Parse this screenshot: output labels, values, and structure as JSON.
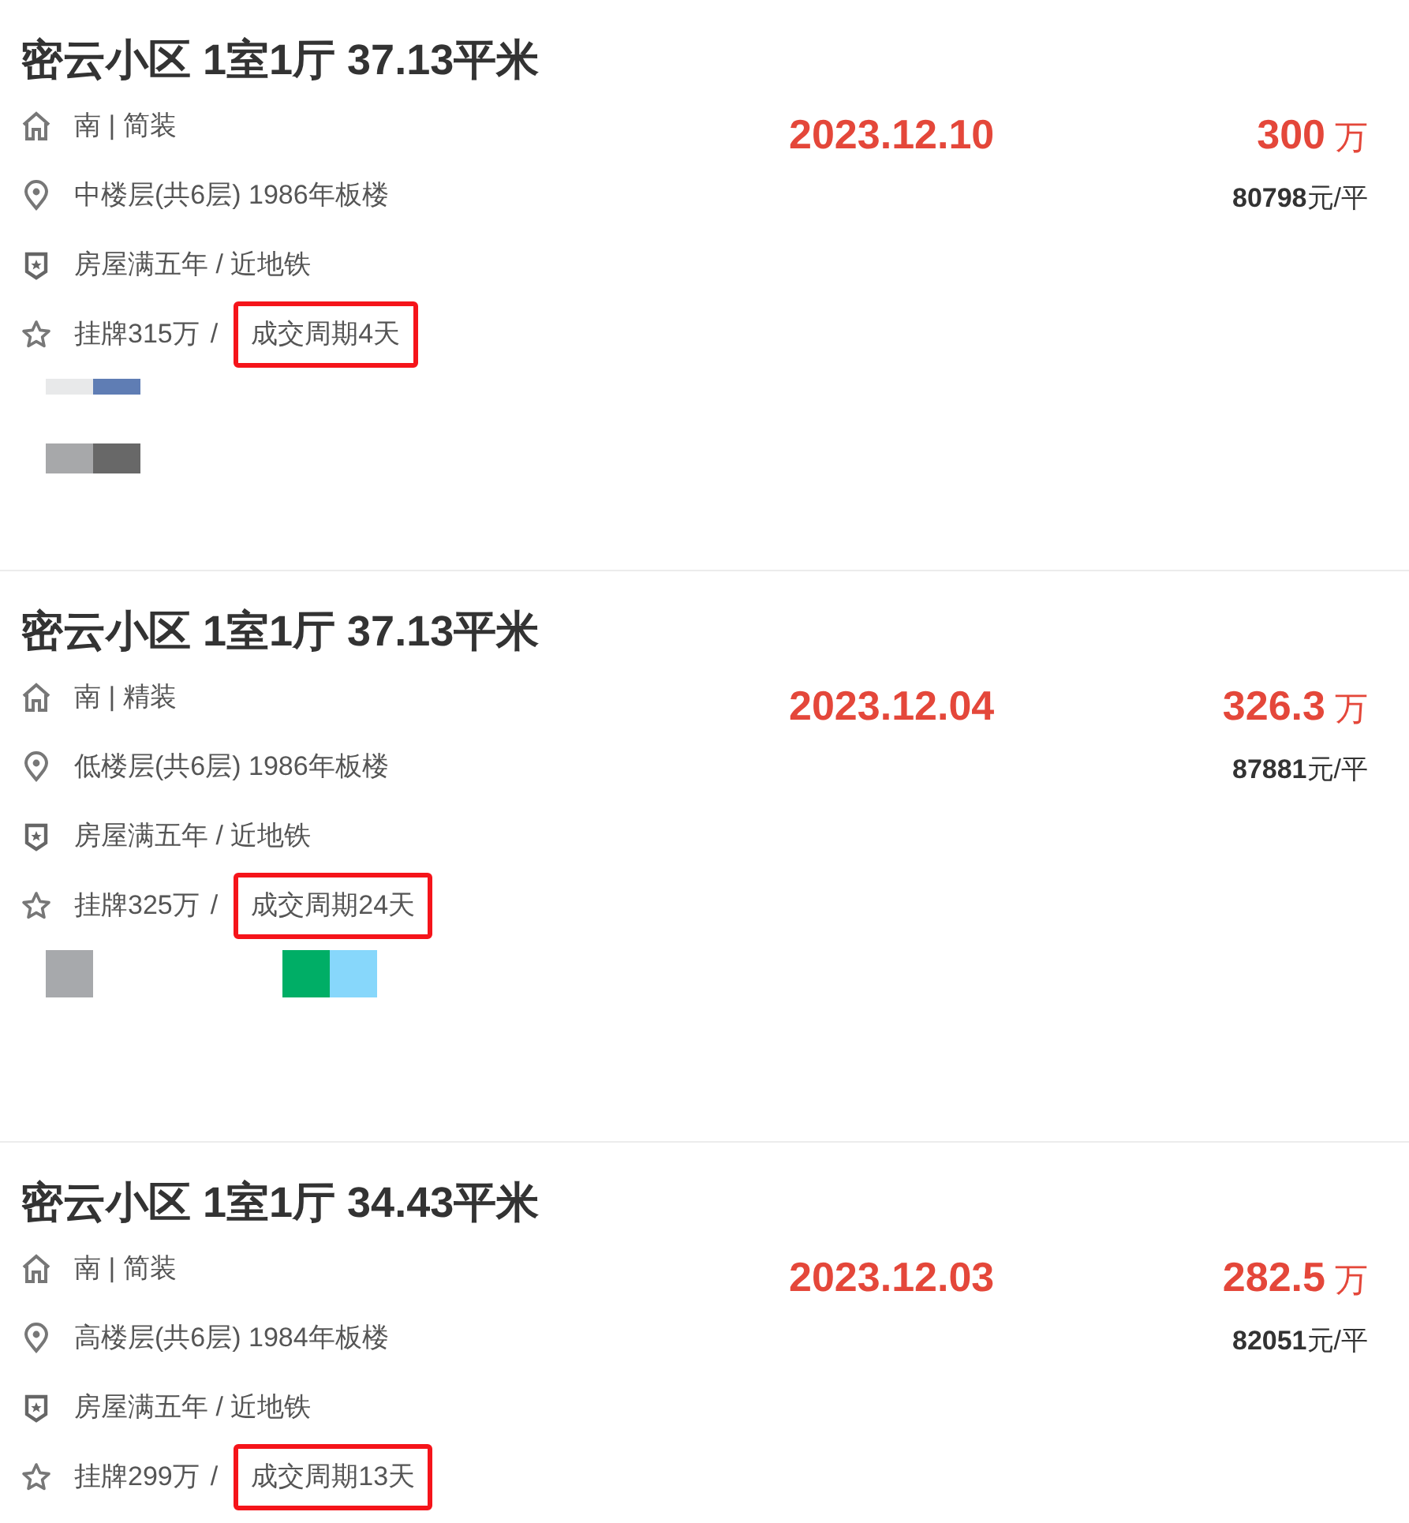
{
  "listings": [
    {
      "title": "密云小区 1室1厅 37.13平米",
      "orientation": "南 | 简装",
      "floor": "中楼层(共6层) 1986年板楼",
      "tags": "房屋满五年 / 近地铁",
      "listed": "挂牌315万",
      "separator": "/",
      "cycle": "成交周期4天",
      "date": "2023.12.10",
      "price": "300",
      "price_unit": "万",
      "unit_price": "80798",
      "unit_price_unit": "元/平",
      "swatch_rows": [
        {
          "kind": "strip",
          "blocks": [
            {
              "color": "#e8e9ea"
            },
            {
              "color": "#5f7db4"
            }
          ]
        },
        {
          "kind": "bar",
          "blocks": [
            {
              "color": "#a7a8aa"
            },
            {
              "color": "#686868"
            }
          ]
        }
      ]
    },
    {
      "title": "密云小区 1室1厅 37.13平米",
      "orientation": "南 | 精装",
      "floor": "低楼层(共6层) 1986年板楼",
      "tags": "房屋满五年 / 近地铁",
      "listed": "挂牌325万",
      "separator": "/",
      "cycle": "成交周期24天",
      "date": "2023.12.04",
      "price": "326.3",
      "price_unit": "万",
      "unit_price": "87881",
      "unit_price_unit": "元/平",
      "swatch_rows": [
        {
          "kind": "square",
          "blocks": [
            {
              "color": "#a7a9ac"
            },
            {
              "kind": "blank"
            },
            {
              "kind": "blank"
            },
            {
              "kind": "blank"
            },
            {
              "kind": "blank"
            },
            {
              "color": "#00ae66"
            },
            {
              "color": "#87d7fb"
            }
          ]
        }
      ]
    },
    {
      "title": "密云小区 1室1厅 34.43平米",
      "orientation": "南 | 简装",
      "floor": "高楼层(共6层) 1984年板楼",
      "tags": "房屋满五年 / 近地铁",
      "listed": "挂牌299万",
      "separator": "/",
      "cycle": "成交周期13天",
      "date": "2023.12.03",
      "price": "282.5",
      "price_unit": "万",
      "unit_price": "82051",
      "unit_price_unit": "元/平"
    }
  ]
}
